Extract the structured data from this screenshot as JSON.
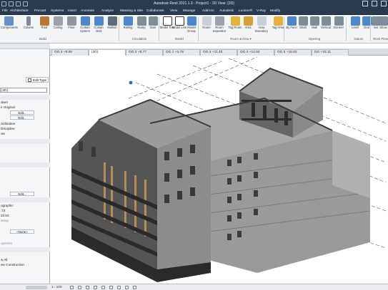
{
  "app": {
    "title": "Autodesk Revit 2021.1.3 - Project1 - 3D View: {3D}"
  },
  "menu": [
    {
      "label": "File"
    },
    {
      "label": "Architecture"
    },
    {
      "label": "Precast"
    },
    {
      "label": "Systems"
    },
    {
      "label": "Insert"
    },
    {
      "label": "Annotate"
    },
    {
      "label": "Analyze"
    },
    {
      "label": "Massing & Site"
    },
    {
      "label": "Collaborate"
    },
    {
      "label": "View"
    },
    {
      "label": "Manage"
    },
    {
      "label": "Add-Ins"
    },
    {
      "label": "Autodesk"
    },
    {
      "label": "Lumion®"
    },
    {
      "label": "V-Ray"
    },
    {
      "label": "Modify"
    }
  ],
  "ribbon": {
    "tools": [
      {
        "label": "Components",
        "color": "#6a8fc4"
      },
      {
        "label": "Column",
        "color": "#7f8c99"
      },
      {
        "label": "Roof",
        "color": "#b6773d"
      },
      {
        "label": "Ceiling",
        "color": "#9aa3ad"
      },
      {
        "label": "Floor",
        "color": "#8d979f"
      },
      {
        "label": "Curtain System",
        "color": "#4f86c6"
      },
      {
        "label": "Curtain Grid",
        "color": "#4f86c6"
      },
      {
        "label": "Mullion",
        "color": "#5e6c7a"
      },
      {
        "label": "Railing",
        "color": "#4f86c6"
      },
      {
        "label": "Ramp",
        "color": "#7f8c99"
      },
      {
        "label": "Stair",
        "color": "#7f8c99"
      },
      {
        "label": "Model Text",
        "color": "#333"
      },
      {
        "label": "Model Line",
        "color": "#333"
      },
      {
        "label": "Model Group",
        "color": "#4f86c6"
      },
      {
        "label": "Room",
        "color": "#c9cfd6"
      },
      {
        "label": "Room Separator",
        "color": "#9aa3ad"
      },
      {
        "label": "Tag Room",
        "color": "#e2b53a"
      },
      {
        "label": "Area",
        "color": "#d4a03a"
      },
      {
        "label": "Area Boundary",
        "color": "#c9cfd6"
      },
      {
        "label": "Tag Area",
        "color": "#e2b53a"
      },
      {
        "label": "By Face",
        "color": "#4f86c6"
      },
      {
        "label": "Shaft",
        "color": "#7f8c99"
      },
      {
        "label": "Wall",
        "color": "#7f8c99"
      },
      {
        "label": "Vertical",
        "color": "#7f8c99"
      },
      {
        "label": "Dormer",
        "color": "#7f8c99"
      },
      {
        "label": "Level",
        "color": "#4f86c6"
      },
      {
        "label": "Grid",
        "color": "#4f86c6"
      },
      {
        "label": "Set",
        "color": "#7f8c99"
      },
      {
        "label": "Show",
        "color": "#7f8c99"
      }
    ],
    "panels": [
      {
        "label": "Build"
      },
      {
        "label": "Circulation"
      },
      {
        "label": "Model"
      },
      {
        "label": "Room & Area ▾"
      },
      {
        "label": "Opening"
      },
      {
        "label": "Datum"
      },
      {
        "label": "Work Plane"
      }
    ]
  },
  "left_panel": {
    "edit_type": "Edit Type",
    "rows": [
      {
        "text": ""
      },
      {
        "text": "{3D}"
      },
      {
        "text": ""
      },
      {
        "text": "dium"
      },
      {
        "text": "e Original"
      },
      {
        "text": "Edit..."
      },
      {
        "text": "Edit..."
      },
      {
        "text": "ordination"
      },
      {
        "text": "Discipline"
      },
      {
        "text": "ow"
      },
      {
        "text": ""
      },
      {
        "text": ""
      },
      {
        "text": ""
      },
      {
        "text": ""
      },
      {
        "text": ""
      },
      {
        "text": ""
      },
      {
        "text": "Edit..."
      },
      {
        "text": ""
      },
      {
        "text": "ographic"
      },
      {
        "text": ".72"
      },
      {
        "text": "33.53"
      },
      {
        "text": "isting"
      },
      {
        "text": "<None>"
      },
      {
        "text": "operties"
      },
      {
        "text": ""
      },
      {
        "text": "w All"
      },
      {
        "text": "ew Construction"
      }
    ]
  },
  "view_tabs": [
    {
      "label": "OG 3 +9.69"
    },
    {
      "label": "{3D}"
    },
    {
      "label": "OG 2 +8.77"
    },
    {
      "label": "OG 1 +3.75"
    },
    {
      "label": "OG 3 +11.45"
    },
    {
      "label": "OG 4 +14.54"
    },
    {
      "label": "OG 5 +16.83"
    },
    {
      "label": "DG +18.11"
    }
  ],
  "status": {
    "scale": "1 : 100"
  },
  "colors": {
    "titlebar": "#2b3a4f",
    "ribbon_bg": "#f3f4f6",
    "building_light": "#a6a6a6",
    "building_mid": "#8c8c8c",
    "building_dark": "#595959",
    "building_black": "#2a2a2a",
    "timber_accent": "#b48e5a"
  }
}
